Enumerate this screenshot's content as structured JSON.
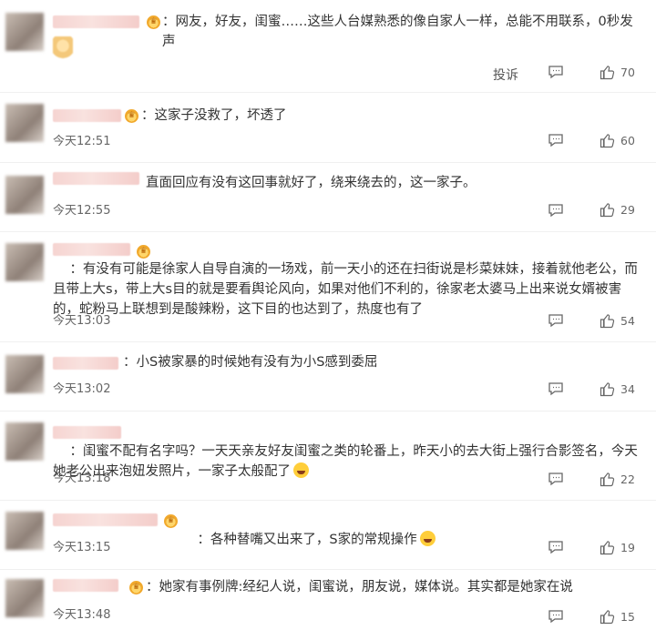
{
  "comments": [
    {
      "text": "：网友，好友，闺蜜……这些人台媒熟悉的像自家人一样，总能不用联系，0秒发声",
      "time": "",
      "report": "投诉",
      "likes": "70"
    },
    {
      "text": "：这家子没救了，坏透了",
      "time": "今天12:51",
      "likes": "60"
    },
    {
      "text": "直面回应有没有这回事就好了，绕来绕去的，这一家子。",
      "time": "今天12:55",
      "likes": "29"
    },
    {
      "text": "：有没有可能是徐家人自导自演的一场戏，前一天小的还在扫街说是杉菜妹妹，接着就他老公，而且带上大s，带上大s目的就是要看舆论风向，如果对他们不利的，徐家老太婆马上出来说女婿被害的，蛇粉马上联想到是酸辣粉，这下目的也达到了，热度也有了",
      "time": "今天13:03",
      "likes": "54"
    },
    {
      "text": "：小S被家暴的时候她有没有为小S感到委屈",
      "time": "今天13:02",
      "likes": "34"
    },
    {
      "text": "：闺蜜不配有名字吗？一天天亲友好友闺蜜之类的轮番上，昨天小的去大街上强行合影签名，今天她老公出来泡妞发照片，一家子太般配了",
      "time": "今天13:18",
      "likes": "22"
    },
    {
      "text": "：各种替嘴又出来了，S家的常规操作",
      "time": "今天13:15",
      "likes": "19"
    },
    {
      "text": "：她家有事例牌:经纪人说，闺蜜说，朋友说，媒体说。其实都是她家在说",
      "time": "今天13:48",
      "likes": "15"
    }
  ],
  "icons": {
    "comment": "comment-icon",
    "like": "thumbs-up-icon",
    "badge": "crown-badge-icon",
    "emoji": "laughing-emoji-icon"
  }
}
